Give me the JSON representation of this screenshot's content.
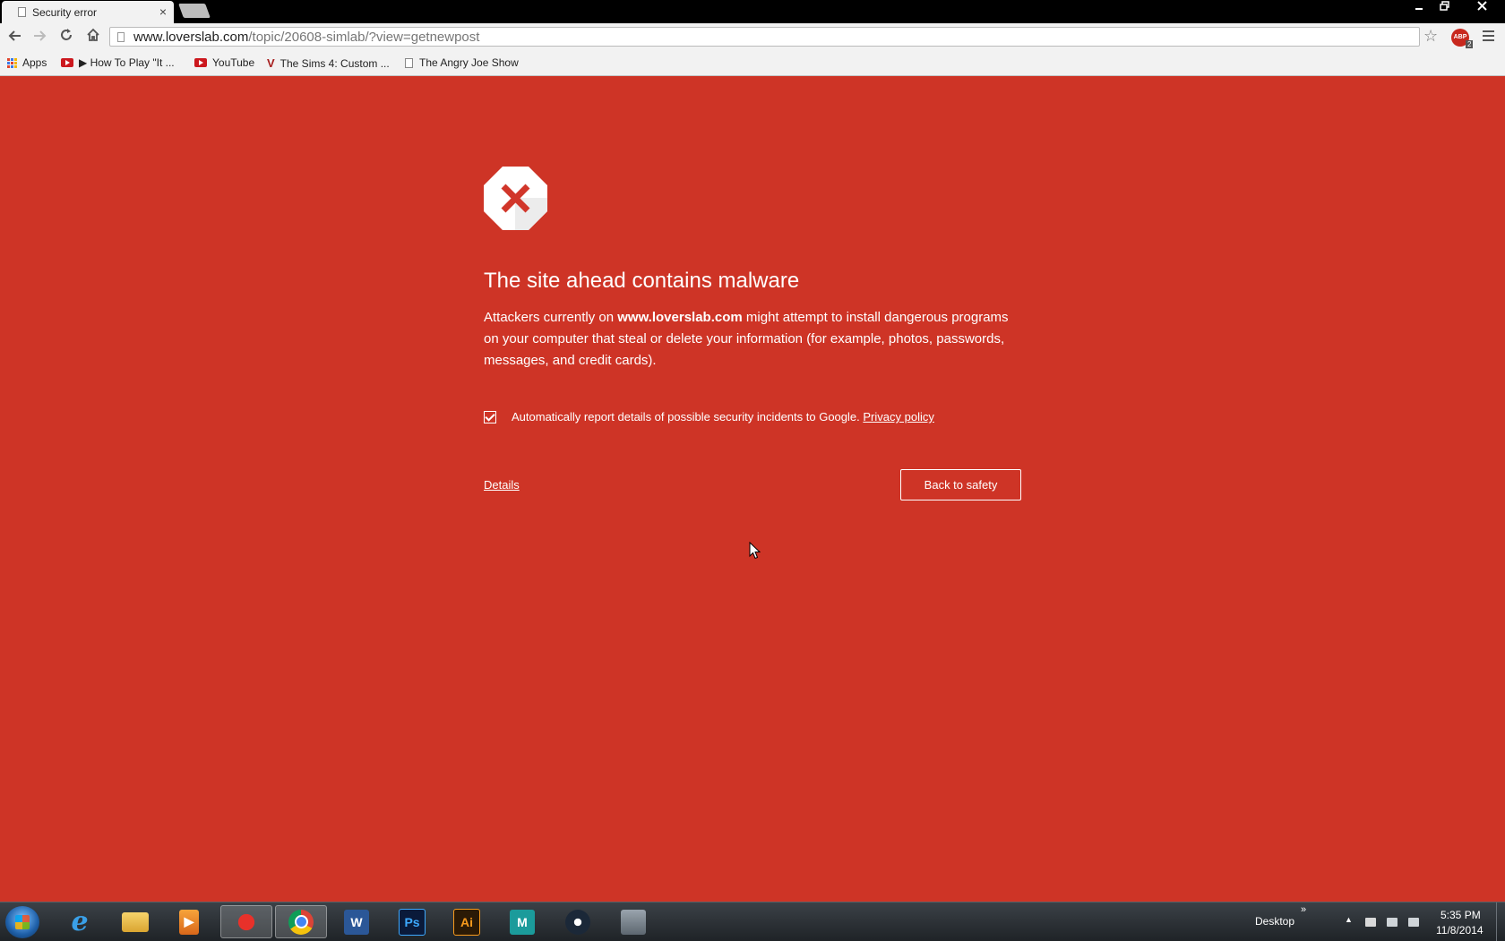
{
  "browser": {
    "tab_title": "Security error",
    "tab_close": "×",
    "url_host": "www.loverslab.com",
    "url_path": "/topic/20608-simlab/?view=getnewpost",
    "extension_badge": "ABP",
    "extension_count": "2"
  },
  "bookmarks": [
    {
      "label": "Apps",
      "icon": "apps-icon"
    },
    {
      "label": "▶ How To Play \"It ...",
      "icon": "youtube-icon"
    },
    {
      "label": "YouTube",
      "icon": "youtube-icon"
    },
    {
      "label": "The Sims 4: Custom ...",
      "icon": "v-icon"
    },
    {
      "label": "The Angry Joe Show",
      "icon": "document-icon"
    }
  ],
  "interstitial": {
    "heading": "The site ahead contains malware",
    "message_prefix": "Attackers currently on ",
    "message_site": "www.loverslab.com",
    "message_suffix": " might attempt to install dangerous programs on your computer that steal or delete your information (for example, photos, passwords, messages, and credit cards).",
    "report_label": "Automatically report details of possible security incidents to Google. ",
    "privacy_link": "Privacy policy",
    "details_link": "Details",
    "back_button": "Back to safety",
    "report_checked": true,
    "background_color": "#ce3426"
  },
  "taskbar": {
    "apps": [
      {
        "name": "internet-explorer-icon",
        "label": "e"
      },
      {
        "name": "file-explorer-icon",
        "label": ""
      },
      {
        "name": "media-player-icon",
        "label": "▶"
      },
      {
        "name": "paint-app-icon",
        "label": ""
      },
      {
        "name": "chrome-icon",
        "label": ""
      },
      {
        "name": "word-icon",
        "label": "W"
      },
      {
        "name": "photoshop-icon",
        "label": "Ps"
      },
      {
        "name": "illustrator-icon",
        "label": "Ai"
      },
      {
        "name": "maya-icon",
        "label": "M"
      },
      {
        "name": "steam-icon",
        "label": ""
      },
      {
        "name": "settings-tool-icon",
        "label": ""
      }
    ],
    "desktop_label": "Desktop",
    "chevron": "»",
    "time": "5:35 PM",
    "date": "11/8/2014"
  }
}
